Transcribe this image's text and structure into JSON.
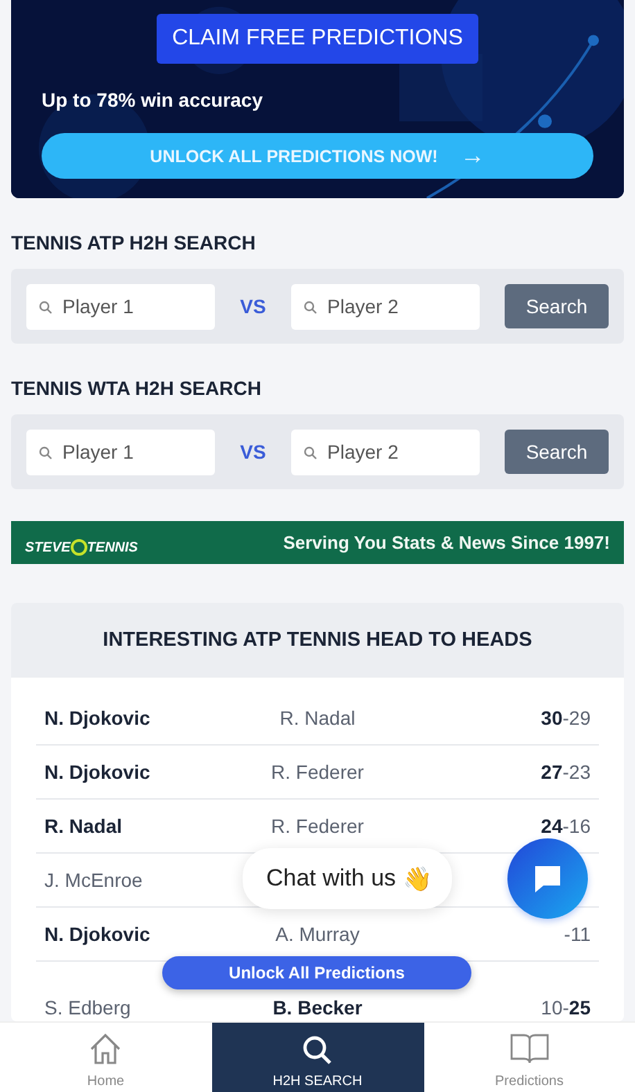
{
  "promo": {
    "claim_button": "CLAIM FREE PREDICTIONS",
    "tagline": "Up to 78% win accuracy",
    "unlock_button": "UNLOCK ALL PREDICTIONS NOW!",
    "arrow": "→"
  },
  "searches": [
    {
      "title": "TENNIS ATP H2H SEARCH",
      "player1_placeholder": "Player 1",
      "vs": "VS",
      "player2_placeholder": "Player 2",
      "button": "Search"
    },
    {
      "title": "TENNIS WTA H2H SEARCH",
      "player1_placeholder": "Player 1",
      "vs": "VS",
      "player2_placeholder": "Player 2",
      "button": "Search"
    }
  ],
  "ad_banner": {
    "logo_left": "STEVE",
    "logo_right": "TENNIS",
    "slogan": "Serving You Stats & News Since 1997!"
  },
  "h2h": {
    "title": "INTERESTING ATP TENNIS HEAD TO HEADS",
    "rows": [
      {
        "player1": {
          "name": "N. Djokovic",
          "bold": true
        },
        "player2": {
          "name": "R. Nadal",
          "bold": false
        },
        "score": "**30**-29"
      },
      {
        "player1": {
          "name": "N. Djokovic",
          "bold": true
        },
        "player2": {
          "name": "R. Federer",
          "bold": false
        },
        "score": "**27**-23"
      },
      {
        "player1": {
          "name": "R. Nadal",
          "bold": true
        },
        "player2": {
          "name": "R. Federer",
          "bold": false
        },
        "score": "**24**-16"
      },
      {
        "player1": {
          "name": "J. McEnroe",
          "bold": false
        }
      },
      {
        "player1": {
          "name": "N. Djokovic",
          "bold": true
        },
        "player2": {
          "name": "A. Murray",
          "bold": false
        },
        "score": "-11"
      },
      {
        "player1": {
          "name": "S. Edberg",
          "bold": false
        },
        "player2": {
          "name": "B. Becker",
          "bold": true
        },
        "score": "10-**25**"
      }
    ]
  },
  "chat": {
    "label": "Chat with us",
    "emoji": "👋"
  },
  "unlock_pill": "Unlock All Predictions",
  "nav": [
    {
      "label": "Home",
      "selected": false
    },
    {
      "label": "H2H SEARCH",
      "selected": true
    },
    {
      "label": "Predictions",
      "selected": false
    }
  ]
}
